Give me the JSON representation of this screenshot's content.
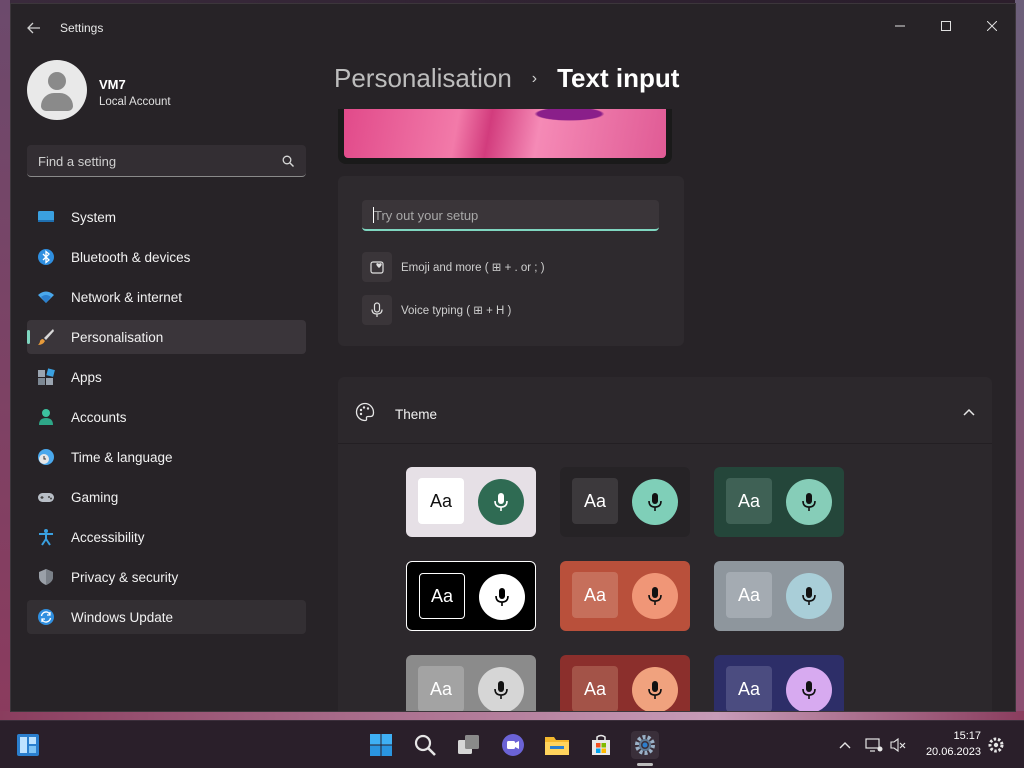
{
  "window": {
    "title": "Settings",
    "controls": {
      "minimize": "minimize",
      "maximize": "maximize",
      "close": "close"
    }
  },
  "user": {
    "name": "VM7",
    "type": "Local Account"
  },
  "search": {
    "placeholder": "Find a setting"
  },
  "nav": {
    "items": [
      {
        "label": "System",
        "icon": "system-icon"
      },
      {
        "label": "Bluetooth & devices",
        "icon": "bluetooth-icon"
      },
      {
        "label": "Network & internet",
        "icon": "wifi-icon"
      },
      {
        "label": "Personalisation",
        "icon": "brush-icon",
        "active": true
      },
      {
        "label": "Apps",
        "icon": "apps-icon"
      },
      {
        "label": "Accounts",
        "icon": "accounts-icon"
      },
      {
        "label": "Time & language",
        "icon": "time-language-icon"
      },
      {
        "label": "Gaming",
        "icon": "gamepad-icon"
      },
      {
        "label": "Accessibility",
        "icon": "accessibility-icon"
      },
      {
        "label": "Privacy & security",
        "icon": "shield-icon"
      },
      {
        "label": "Windows Update",
        "icon": "windows-update-icon",
        "hover": true
      }
    ]
  },
  "breadcrumb": {
    "parent": "Personalisation",
    "separator": "›",
    "current": "Text input"
  },
  "try_panel": {
    "placeholder": "Try out your setup",
    "emoji_label": "Emoji and more ( ⊞ + . or ; )",
    "voice_label": "Voice typing ( ⊞ + H )"
  },
  "theme": {
    "title": "Theme",
    "expanded": true,
    "swatch_text": "Aa",
    "swatches": [
      {
        "bg": "#e6e0e6",
        "aa_bg": "#ffffff",
        "aa_fg": "#111111",
        "mic_bg": "#2f6b53",
        "mic_fg": "#ffffff",
        "selected": false
      },
      {
        "bg": "#262326",
        "aa_bg": "#3c393c",
        "aa_fg": "#ffffff",
        "mic_bg": "#7fcfb8",
        "mic_fg": "#111111",
        "selected": false
      },
      {
        "bg": "#24463a",
        "aa_bg": "#3f6155",
        "aa_fg": "#ffffff",
        "mic_bg": "#86cdb8",
        "mic_fg": "#111111",
        "selected": false
      },
      {
        "bg": "#000000",
        "aa_bg": "#000000",
        "aa_fg": "#ffffff",
        "mic_bg": "#ffffff",
        "mic_fg": "#000000",
        "selected": true
      },
      {
        "bg": "#b9503b",
        "aa_bg": "#c66f5b",
        "aa_fg": "#ffffff",
        "mic_bg": "#f09677",
        "mic_fg": "#111111",
        "selected": false
      },
      {
        "bg": "#8e969d",
        "aa_bg": "#a4abb2",
        "aa_fg": "#ffffff",
        "mic_bg": "#a9ced8",
        "mic_fg": "#111111",
        "selected": false
      },
      {
        "bg": "#8b8b8b",
        "aa_bg": "#a3a3a3",
        "aa_fg": "#ffffff",
        "mic_bg": "#d6d6d6",
        "mic_fg": "#111111",
        "selected": false
      },
      {
        "bg": "#8b2f2c",
        "aa_bg": "#a35348",
        "aa_fg": "#ffffff",
        "mic_bg": "#f0a27e",
        "mic_fg": "#111111",
        "selected": false
      },
      {
        "bg": "#2d2e68",
        "aa_bg": "#4b4c80",
        "aa_fg": "#ffffff",
        "mic_bg": "#d7aaf0",
        "mic_fg": "#111111",
        "selected": false
      }
    ]
  },
  "taskbar": {
    "icons": [
      "widgets-icon",
      "start-icon",
      "search-icon",
      "task-view-icon",
      "teams-chat-icon",
      "file-explorer-icon",
      "store-icon",
      "settings-icon"
    ],
    "tray": [
      "chevron-up-icon",
      "network-icon",
      "volume-muted-icon"
    ],
    "time": "15:17",
    "date": "20.06.2023"
  },
  "colors": {
    "accent": "#7fd6c0",
    "window_bg": "#272327",
    "panel_bg": "#2e2a2e"
  }
}
